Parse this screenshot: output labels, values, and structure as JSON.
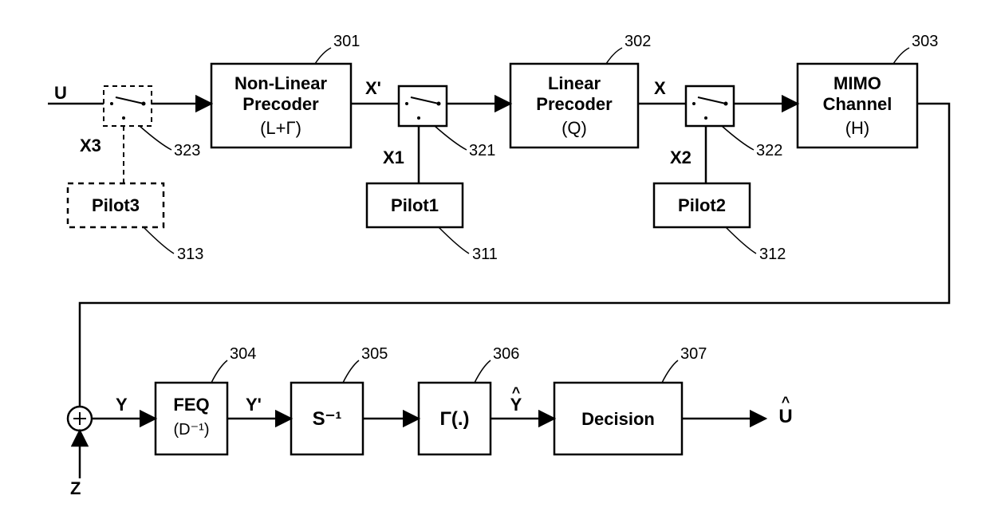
{
  "blocks": {
    "nonlinear": {
      "l1": "Non-Linear",
      "l2": "Precoder",
      "l3": "(L+Γ)",
      "ref": "301"
    },
    "linear": {
      "l1": "Linear",
      "l2": "Precoder",
      "l3": "(Q)",
      "ref": "302"
    },
    "mimo": {
      "l1": "MIMO",
      "l2": "Channel",
      "l3": "(H)",
      "ref": "303"
    },
    "feq": {
      "l1": "FEQ",
      "l2": "(D⁻¹)",
      "ref": "304"
    },
    "sinv": {
      "l1": "S⁻¹",
      "ref": "305"
    },
    "gamma": {
      "l1": "Γ(.)",
      "ref": "306"
    },
    "decision": {
      "l1": "Decision",
      "ref": "307"
    },
    "pilot1": {
      "l1": "Pilot1",
      "ref": "311"
    },
    "pilot2": {
      "l1": "Pilot2",
      "ref": "312"
    },
    "pilot3": {
      "l1": "Pilot3",
      "ref": "313"
    },
    "sw1": {
      "ref": "321"
    },
    "sw2": {
      "ref": "322"
    },
    "sw3": {
      "ref": "323"
    }
  },
  "signals": {
    "U": "U",
    "X3": "X3",
    "Xprime": "X'",
    "X1": "X1",
    "X": "X",
    "X2": "X2",
    "Z": "Z",
    "Y": "Y",
    "Yprime": "Y'",
    "Yhat": "Y",
    "Uhat": "U"
  }
}
